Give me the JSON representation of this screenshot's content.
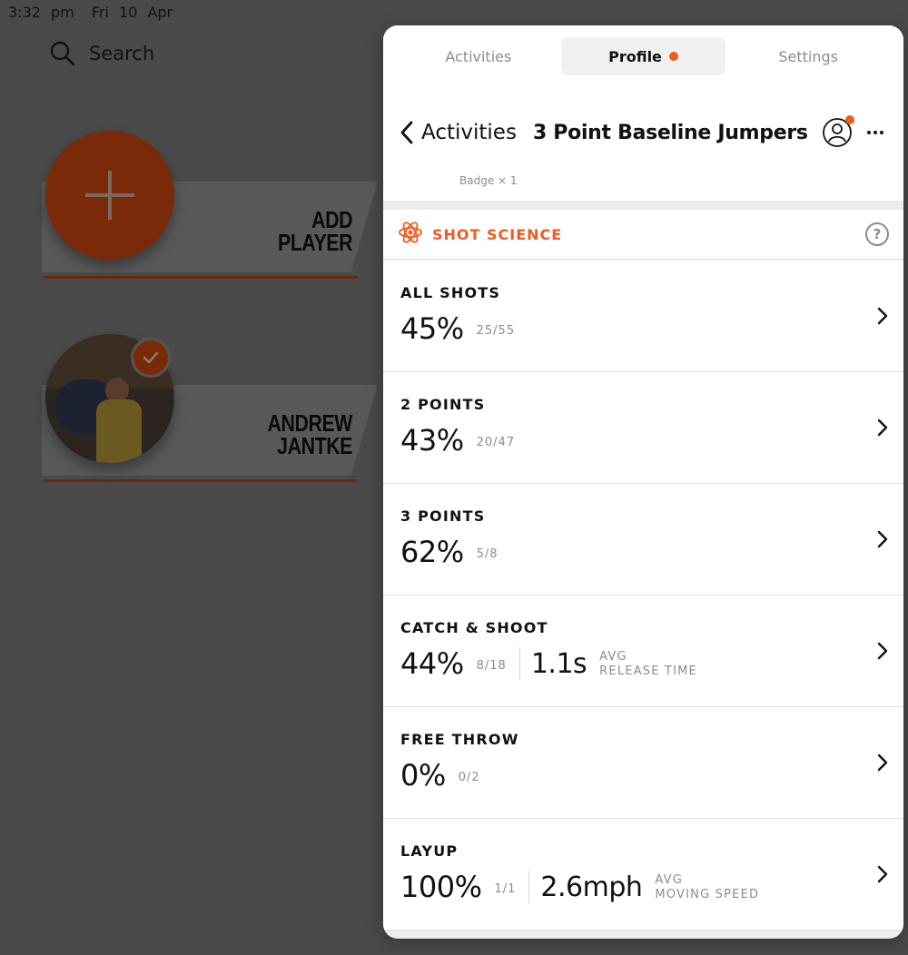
{
  "status_bar": {
    "time": "3:32 pm",
    "date": "Fri 10 Apr"
  },
  "background": {
    "search_label": "Search",
    "add_player": {
      "line1": "ADD",
      "line2": "PLAYER"
    },
    "player": {
      "line1": "ANDREW",
      "line2": "JANTKE"
    }
  },
  "tabs": [
    {
      "label": "Activities",
      "active": false
    },
    {
      "label": "Profile",
      "active": true
    },
    {
      "label": "Settings",
      "active": false
    }
  ],
  "nav": {
    "back_label": "Activities",
    "title": "3 Point Baseline Jumpers",
    "badge_count": "Badge × 1"
  },
  "section": {
    "label": "SHOT SCIENCE",
    "help": "?"
  },
  "stats": [
    {
      "title": "ALL SHOTS",
      "pct": "45%",
      "frac": "25/55"
    },
    {
      "title": "2 POINTS",
      "pct": "43%",
      "frac": "20/47"
    },
    {
      "title": "3 POINTS",
      "pct": "62%",
      "frac": "5/8"
    },
    {
      "title": "CATCH & SHOOT",
      "pct": "44%",
      "frac": "8/18",
      "metric": "1.1s",
      "metric_label_1": "AVG",
      "metric_label_2": "RELEASE TIME"
    },
    {
      "title": "FREE THROW",
      "pct": "0%",
      "frac": "0/2"
    },
    {
      "title": "LAYUP",
      "pct": "100%",
      "frac": "1/1",
      "metric": "2.6mph",
      "metric_label_1": "AVG",
      "metric_label_2": "MOVING SPEED"
    }
  ],
  "colors": {
    "accent": "#f25a1d",
    "muted": "#8c8c8c",
    "dim_background": "#4a4a4a"
  }
}
